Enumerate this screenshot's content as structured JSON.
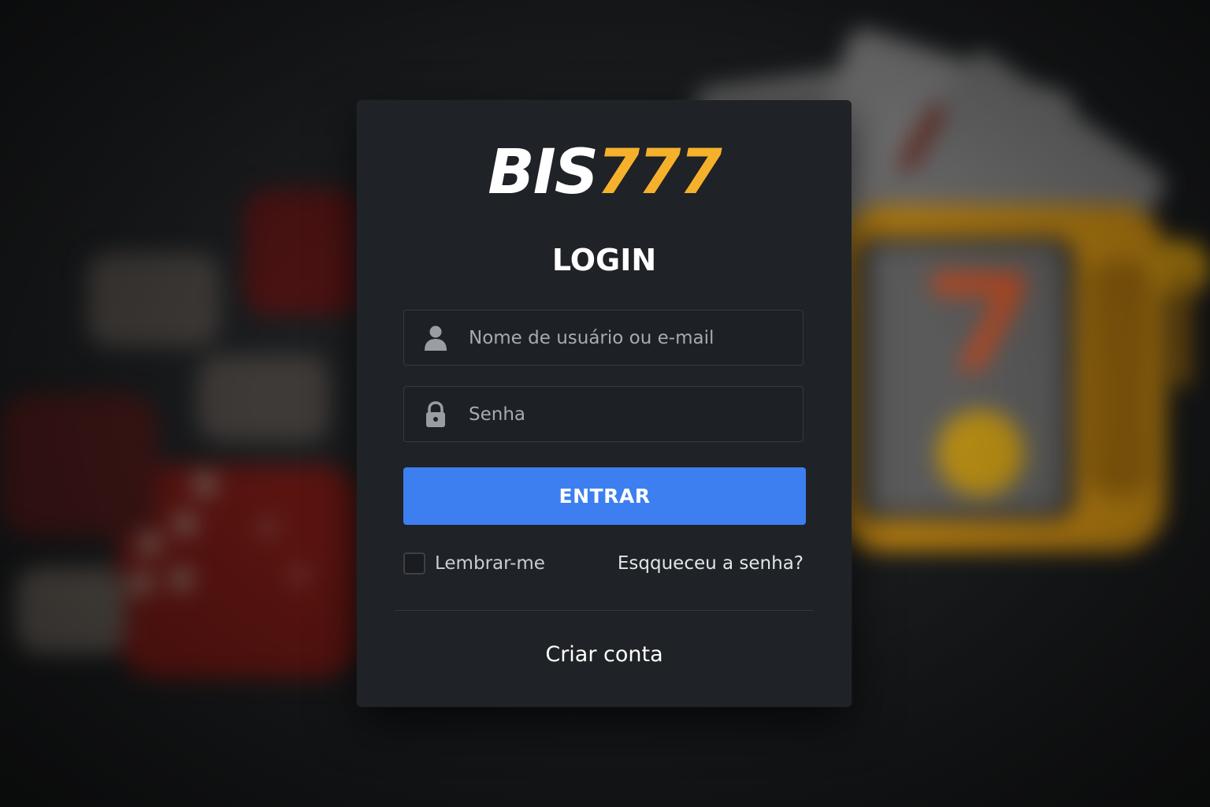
{
  "brand": {
    "logo_text_primary": "BIS",
    "logo_text_accent": "777",
    "primary_color": "#ffffff",
    "accent_color": "#f5b12c"
  },
  "login": {
    "title": "LOGIN",
    "username": {
      "icon": "user-icon",
      "placeholder": "Nome de usuário ou e-mail",
      "value": ""
    },
    "password": {
      "icon": "lock-icon",
      "placeholder": "Senha",
      "value": ""
    },
    "submit_label": "ENTRAR",
    "submit_color": "#3d7ff1",
    "remember_label": "Lembrar-me",
    "remember_checked": false,
    "forgot_label": "Esqqueceu a senha?",
    "create_account_label": "Criar conta"
  },
  "background": {
    "theme": "blurred casino scene",
    "elements": [
      "dice",
      "playing-cards",
      "slot-machine"
    ]
  }
}
